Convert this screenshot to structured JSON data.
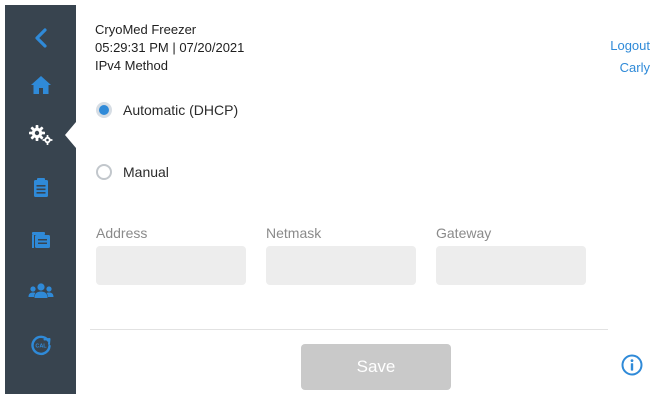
{
  "header": {
    "title": "CryoMed Freezer",
    "datetime": "05:29:31 PM | 07/20/2021",
    "section_title": "IPv4 Method"
  },
  "account": {
    "logout_label": "Logout",
    "username": "Carly"
  },
  "ipv4_method": {
    "options": [
      {
        "label": "Automatic (DHCP)",
        "selected": true
      },
      {
        "label": "Manual",
        "selected": false
      }
    ]
  },
  "fields": {
    "address": {
      "label": "Address",
      "value": ""
    },
    "netmask": {
      "label": "Netmask",
      "value": ""
    },
    "gateway": {
      "label": "Gateway",
      "value": ""
    }
  },
  "actions": {
    "save_label": "Save"
  },
  "sidebar": {
    "items": [
      {
        "icon": "back-chevron-icon",
        "active": false
      },
      {
        "icon": "home-icon",
        "active": false
      },
      {
        "icon": "settings-gears-icon",
        "active": true
      },
      {
        "icon": "clipboard-icon",
        "active": false
      },
      {
        "icon": "files-icon",
        "active": false
      },
      {
        "icon": "users-icon",
        "active": false
      },
      {
        "icon": "calibration-icon",
        "active": false
      }
    ]
  },
  "colors": {
    "sidebar_bg": "#38444f",
    "accent": "#2f8ad8",
    "button_disabled": "#c9c9c9",
    "input_bg": "#ededed"
  }
}
